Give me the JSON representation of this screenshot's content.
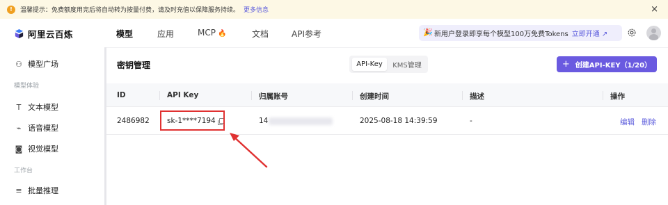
{
  "notice": {
    "text": "温馨提示：免费额度用完后将自动转为按量付费，请及时充值以保障服务持续。",
    "more_link": "更多信息",
    "close": "×"
  },
  "brand": {
    "name": "阿里云百炼"
  },
  "nav": [
    {
      "label": "模型"
    },
    {
      "label": "应用"
    },
    {
      "label": "MCP"
    },
    {
      "label": "文档"
    },
    {
      "label": "API参考"
    }
  ],
  "promo": {
    "text": "新用户登录即享每个模型100万免费Tokens",
    "link": "立即开通 ↗"
  },
  "sidebar": {
    "items": [
      {
        "label": "模型广场",
        "icon": "⚇"
      },
      {
        "group": "模型体验"
      },
      {
        "label": "文本模型",
        "icon": "T"
      },
      {
        "label": "语音模型",
        "icon": "⌁"
      },
      {
        "label": "视觉模型",
        "icon": "◙"
      },
      {
        "group": "工作台"
      },
      {
        "label": "批量推理",
        "icon": "≡"
      }
    ]
  },
  "main": {
    "title": "密钥管理",
    "tabs": [
      {
        "label": "API-Key"
      },
      {
        "label": "KMS管理"
      }
    ],
    "create_button": "创建API-KEY（1/20）",
    "columns": [
      "ID",
      "API Key",
      "归属账号",
      "创建时间",
      "描述",
      "操作"
    ],
    "rows": [
      {
        "id": "2486982",
        "api_key": "sk-1****7194",
        "account": "14",
        "created": "2025-08-18 14:39:59",
        "desc": "-",
        "actions": [
          "编辑",
          "删除"
        ]
      }
    ]
  },
  "colors": {
    "accent": "#6a5ae0",
    "link": "#5b5bdc",
    "highlight": "#e03131"
  }
}
